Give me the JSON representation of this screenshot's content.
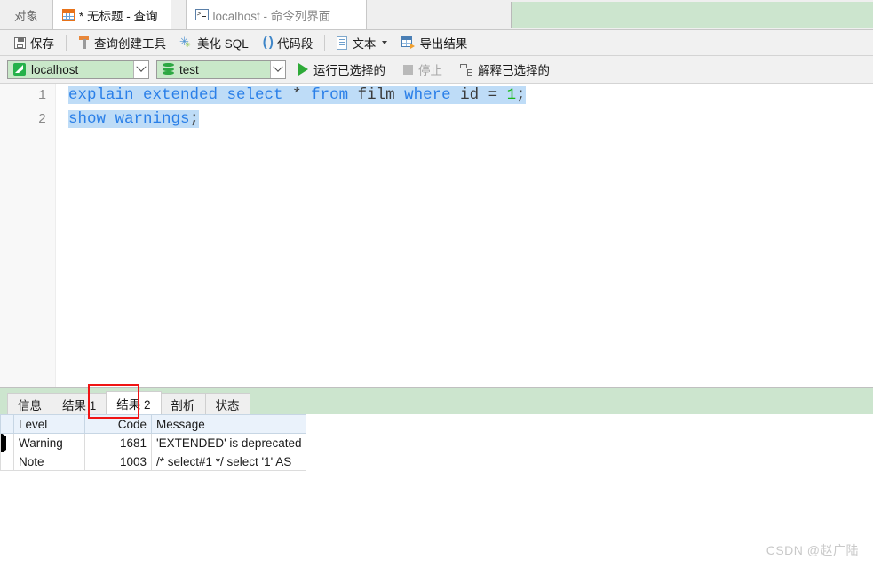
{
  "window_tabs": [
    {
      "label": "对象",
      "icon": "none",
      "state": "inactive"
    },
    {
      "label": "* 无标题 - 查询",
      "icon": "grid-icon",
      "state": "active"
    },
    {
      "label": "localhost - 命令列界面",
      "icon": "console-icon",
      "state": "inactive"
    }
  ],
  "toolbar": {
    "save_label": "保存",
    "query_builder_label": "查询创建工具",
    "beautify_label": "美化 SQL",
    "snippet_label": "代码段",
    "text_label": "文本",
    "export_label": "导出结果"
  },
  "connection_bar": {
    "connection_value": "localhost",
    "database_value": "test",
    "run_selected_label": "运行已选择的",
    "stop_label": "停止",
    "explain_selected_label": "解释已选择的"
  },
  "editor": {
    "line_numbers": [
      "1",
      "2"
    ],
    "line1": {
      "t1": "explain extended select",
      "t2": " * ",
      "t3": "from",
      "t4": " film ",
      "t5": "where",
      "t6": " id = ",
      "t7": "1",
      "t8": ";"
    },
    "line2": {
      "t1": "show warnings",
      "t2": ";"
    }
  },
  "result_tabs": [
    {
      "label": "信息",
      "selected": false
    },
    {
      "label": "结果 1",
      "selected": false
    },
    {
      "label": "结果 2",
      "selected": true
    },
    {
      "label": "剖析",
      "selected": false
    },
    {
      "label": "状态",
      "selected": false
    }
  ],
  "result_grid": {
    "columns": [
      "Level",
      "Code",
      "Message"
    ],
    "rows": [
      {
        "marker": true,
        "level": "Warning",
        "code": "1681",
        "message": "'EXTENDED' is deprecated"
      },
      {
        "marker": false,
        "level": "Note",
        "code": "1003",
        "message": "/* select#1 */ select '1' AS"
      }
    ]
  },
  "watermark": "CSDN @赵广陆",
  "colors": {
    "panel_green": "#cce5ce",
    "selection_blue": "#bedcf7",
    "keyword_blue": "#2a7fe8",
    "number_green": "#18b818",
    "highlight_red": "#f01414"
  }
}
